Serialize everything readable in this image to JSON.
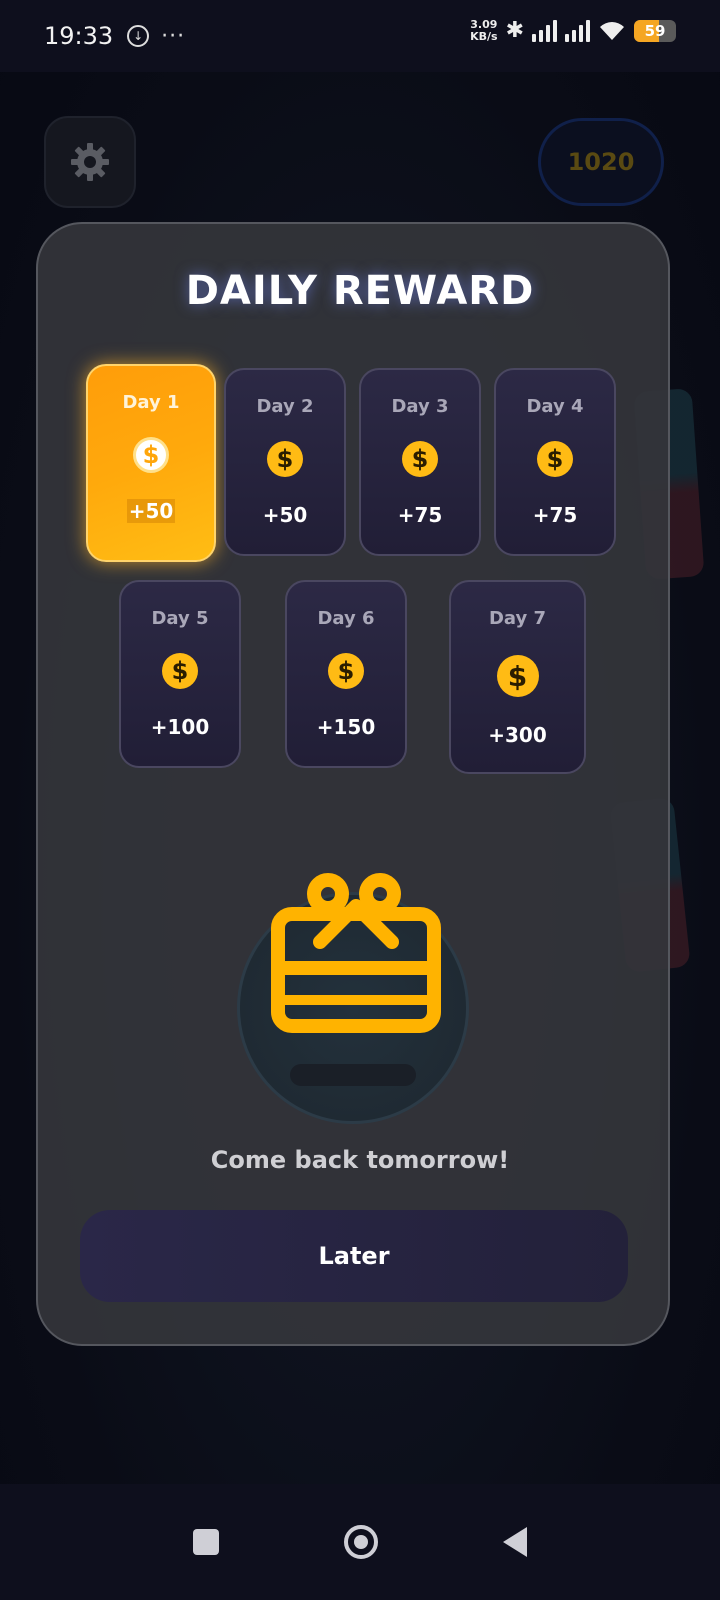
{
  "status_bar": {
    "time": "19:33",
    "speed_value": "3.09",
    "speed_unit": "KB/s",
    "battery": "59",
    "icons": [
      "download-icon",
      "more-icon",
      "bluetooth-icon",
      "signal-icon",
      "signal-icon",
      "wifi-icon",
      "battery-icon"
    ]
  },
  "header": {
    "coins": "1020"
  },
  "modal": {
    "title": "DAILY REWARD",
    "days": [
      {
        "label": "Day 1",
        "amount": "+50",
        "active": true
      },
      {
        "label": "Day 2",
        "amount": "+50",
        "active": false
      },
      {
        "label": "Day 3",
        "amount": "+75",
        "active": false
      },
      {
        "label": "Day 4",
        "amount": "+75",
        "active": false
      },
      {
        "label": "Day 5",
        "amount": "+100",
        "active": false
      },
      {
        "label": "Day 6",
        "amount": "+150",
        "active": false
      },
      {
        "label": "Day 7",
        "amount": "+300",
        "active": false
      }
    ],
    "coin_symbol": "$",
    "message": "Come back tomorrow!",
    "later_label": "Later"
  },
  "colors": {
    "accent": "#FFB300",
    "active_card": "#FFA60B",
    "card_bg": "#262339"
  }
}
